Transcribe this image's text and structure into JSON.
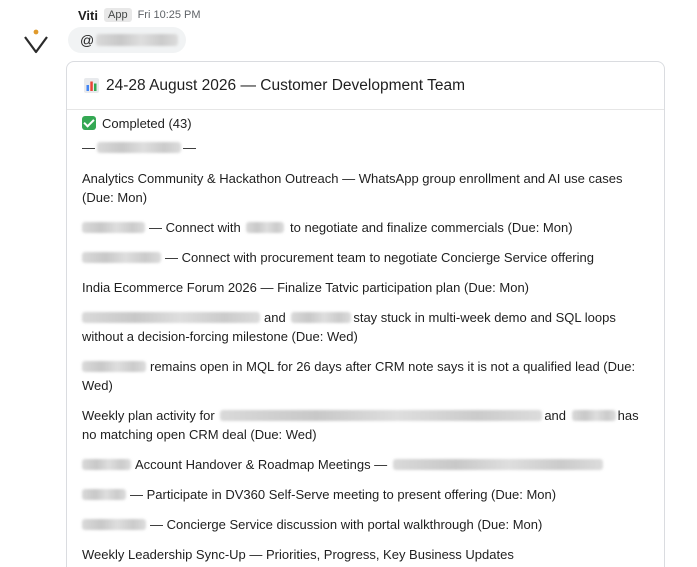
{
  "message": {
    "sender": "Viti",
    "badge": "App",
    "time": "Fri 10:25 PM",
    "mention_prefix": "@"
  },
  "card": {
    "title": "24-28 August 2026 — Customer Development Team",
    "icon": "bar-chart-icon",
    "section_label": "Completed (43)",
    "dash": "—",
    "items": [
      {
        "a": "Analytics Community & Hackathon Outreach — WhatsApp group enrollment and AI use cases",
        "b": "(Due: Mon)"
      },
      {
        "a": "— Connect with",
        "b": "to negotiate and finalize commercials (Due: Mon)"
      },
      {
        "a": "— Connect with procurement team to negotiate Concierge Service offering"
      },
      {
        "a": "India Ecommerce Forum 2026 — Finalize Tatvic participation plan (Due: Mon)"
      },
      {
        "a": "and",
        "b": "stay stuck in multi-week demo and SQL loops",
        "c": "without a decision-forcing milestone (Due: Wed)"
      },
      {
        "a": "remains open in MQL for 26 days after CRM note says it is not a qualified lead (Due:",
        "b": "Wed)"
      },
      {
        "a": "Weekly plan activity for",
        "b": "and",
        "c": "has",
        "d": "no matching open CRM deal (Due: Wed)"
      },
      {
        "a": "Account Handover & Roadmap Meetings —"
      },
      {
        "a": "— Participate in DV360 Self-Serve meeting to present offering (Due: Mon)"
      },
      {
        "a": "— Concierge Service discussion with portal walkthrough (Due: Mon)"
      },
      {
        "a": "Weekly Leadership Sync-Up — Priorities, Progress, Key Business Updates"
      }
    ]
  },
  "colors": {
    "check": "#34a853",
    "border": "#dadce0",
    "text": "#1f1f1f",
    "muted": "#5f6368"
  }
}
